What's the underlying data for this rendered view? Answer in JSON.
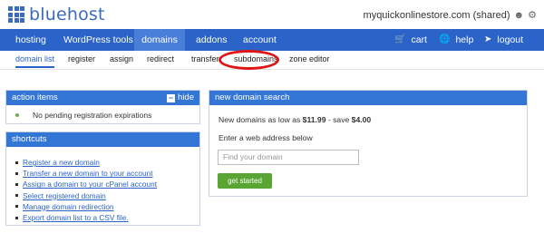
{
  "brand": {
    "name": "bluehost"
  },
  "account": {
    "label": "myquickonlinestore.com (shared)",
    "icons": [
      "user-icon",
      "gear-icon"
    ]
  },
  "nav": {
    "items": [
      "hosting",
      "WordPress tools",
      "domains",
      "addons",
      "account"
    ],
    "active": "domains",
    "right": [
      {
        "label": "cart",
        "icon": "cart-icon"
      },
      {
        "label": "help",
        "icon": "globe-icon"
      },
      {
        "label": "logout",
        "icon": "logout-icon"
      }
    ]
  },
  "subnav": {
    "items": [
      "domain list",
      "register",
      "assign",
      "redirect",
      "transfer",
      "subdomains",
      "zone editor"
    ],
    "active": "domain list",
    "highlighted": "subdomains"
  },
  "action_items": {
    "title": "action items",
    "hide_label": "hide",
    "message": "No pending registration expirations"
  },
  "shortcuts": {
    "title": "shortcuts",
    "links": [
      "Register a new domain",
      "Transfer a new domain to your account",
      "Assign a domain to your cPanel account",
      "Select registered domain",
      "Manage domain redirection",
      "Export domain list to a CSV file."
    ]
  },
  "search": {
    "title": "new domain search",
    "price_prefix": "New domains as low as ",
    "price": "$11.99",
    "save_text": " - save ",
    "save_amount": "$4.00",
    "instruction": "Enter a web address below",
    "placeholder": "Find your domain",
    "button": "get started"
  },
  "colors": {
    "brand_blue": "#2b63c8",
    "panel_header": "#3476d6",
    "button_green": "#5aa433",
    "highlight_circle": "#e01616"
  }
}
